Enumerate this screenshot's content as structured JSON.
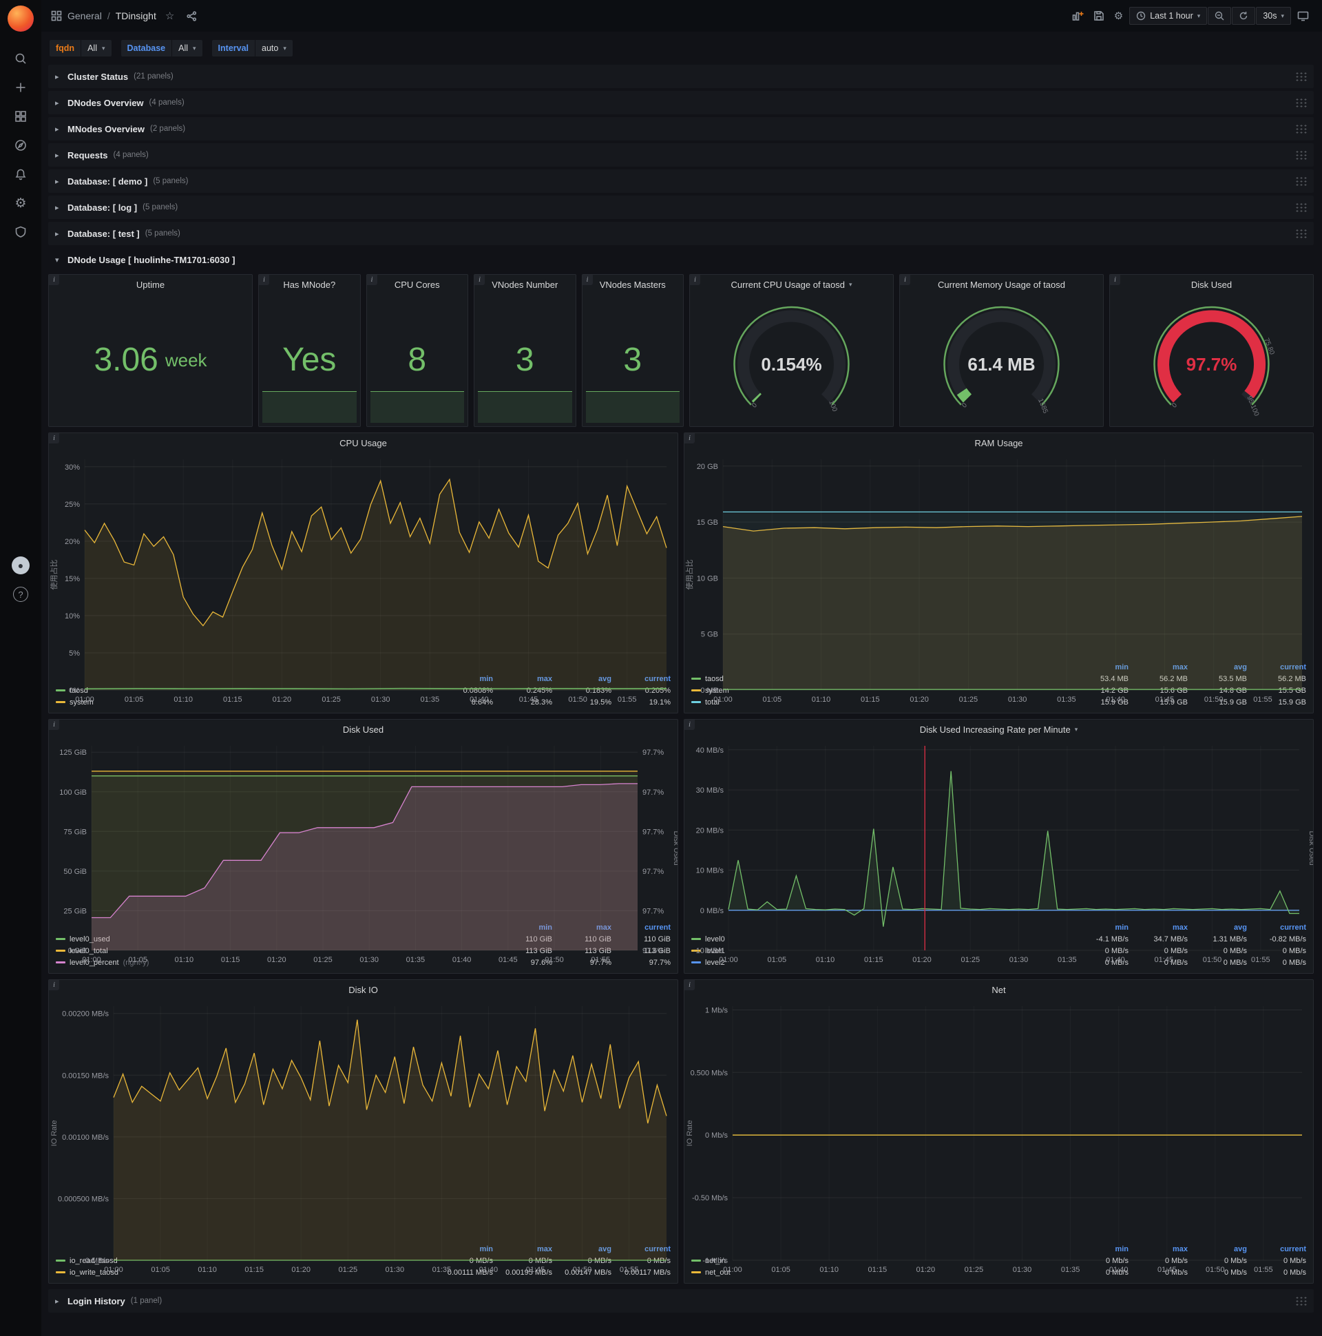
{
  "topnav": {
    "folder": "General",
    "separator": "/",
    "title": "TDinsight",
    "time_range": "Last 1 hour",
    "refresh": "30s"
  },
  "variables": [
    {
      "label": "fqdn",
      "value": "All",
      "color": "#eb7b18"
    },
    {
      "label": "Database",
      "value": "All",
      "color": "#5794f2"
    },
    {
      "label": "Interval",
      "value": "auto",
      "color": "#5794f2"
    }
  ],
  "collapsed_rows": [
    {
      "title": "Cluster Status",
      "count": "(21 panels)"
    },
    {
      "title": "DNodes Overview",
      "count": "(4 panels)"
    },
    {
      "title": "MNodes Overview",
      "count": "(2 panels)"
    },
    {
      "title": "Requests",
      "count": "(4 panels)"
    },
    {
      "title": "Database: [ demo ]",
      "count": "(5 panels)"
    },
    {
      "title": "Database: [ log ]",
      "count": "(5 panels)"
    },
    {
      "title": "Database: [ test ]",
      "count": "(5 panels)"
    }
  ],
  "expanded_row": {
    "title": "DNode Usage [ huolinhe-TM1701:6030 ]"
  },
  "bottom_row": {
    "title": "Login History",
    "count": "(1 panel)"
  },
  "stat_panels": [
    {
      "title": "Uptime",
      "value": "3.06",
      "unit": "week"
    },
    {
      "title": "Has MNode?",
      "value": "Yes",
      "unit": ""
    },
    {
      "title": "CPU Cores",
      "value": "8",
      "unit": ""
    },
    {
      "title": "VNodes Number",
      "value": "3",
      "unit": ""
    },
    {
      "title": "VNodes Masters",
      "value": "3",
      "unit": ""
    }
  ],
  "gauge_panels": [
    {
      "title": "Current CPU Usage of taosd",
      "value": "0.154%",
      "percent": 0.154,
      "min": "0",
      "max": "100",
      "color": "#73bf69",
      "value_color": "#d8d9da"
    },
    {
      "title": "Current Memory Usage of taosd",
      "value": "61.4 MB",
      "percent": 3.9,
      "min": "0",
      "max": "1585",
      "color": "#73bf69",
      "value_color": "#d8d9da"
    },
    {
      "title": "Disk Used",
      "value": "97.7%",
      "percent": 97.7,
      "min": "0",
      "max": "95.100",
      "mid": "75.80",
      "color": "#e02f44",
      "value_color": "#e02f44"
    }
  ],
  "chart_data": [
    {
      "id": "cpu_usage",
      "type": "line",
      "title": "CPU Usage",
      "ylabel": "使用占比",
      "ylim": [
        0,
        31
      ],
      "ml": 52,
      "grid": true,
      "legend_position": "bottom",
      "yticks": [
        {
          "v": 0,
          "t": "0%"
        },
        {
          "v": 5,
          "t": "5%"
        },
        {
          "v": 10,
          "t": "10%"
        },
        {
          "v": 15,
          "t": "15%"
        },
        {
          "v": 20,
          "t": "20%"
        },
        {
          "v": 25,
          "t": "25%"
        },
        {
          "v": 30,
          "t": "30%"
        }
      ],
      "xticks": [
        "01:00",
        "01:05",
        "01:10",
        "01:15",
        "01:20",
        "01:25",
        "01:30",
        "01:35",
        "01:40",
        "01:45",
        "01:50",
        "01:55"
      ],
      "series": [
        {
          "name": "system",
          "color": "#eab839",
          "fill": 0.1,
          "values": [
            21.5,
            19.8,
            22.4,
            20.1,
            17.2,
            16.8,
            21.0,
            19.3,
            20.6,
            18.2,
            12.5,
            10.2,
            8.64,
            10.5,
            9.8,
            13.2,
            16.5,
            18.9,
            23.8,
            19.4,
            16.2,
            21.3,
            18.6,
            23.4,
            24.6,
            20.2,
            21.8,
            18.4,
            20.3,
            24.9,
            28.1,
            22.4,
            25.2,
            20.6,
            23.1,
            19.7,
            26.3,
            28.3,
            21.2,
            18.5,
            22.6,
            20.4,
            24.3,
            21.1,
            19.2,
            23.5,
            17.3,
            16.4,
            20.8,
            22.4,
            25.1,
            18.3,
            21.6,
            26.2,
            19.4,
            27.4,
            24.2,
            21.0,
            23.3,
            19.1
          ]
        },
        {
          "name": "taosd",
          "color": "#73bf69",
          "fill": 0.2,
          "values": [
            0.18,
            0.22,
            0.19,
            0.21,
            0.2,
            0.18,
            0.23,
            0.2,
            0.19,
            0.22,
            0.2,
            0.21
          ]
        }
      ],
      "legend": {
        "cols": [
          "min",
          "max",
          "avg",
          "current"
        ],
        "rows": [
          {
            "name": "taosd",
            "color": "#73bf69",
            "values": [
              "0.0808%",
              "0.245%",
              "0.183%",
              "0.205%"
            ]
          },
          {
            "name": "system",
            "color": "#eab839",
            "values": [
              "8.64%",
              "28.3%",
              "19.5%",
              "19.1%"
            ]
          }
        ]
      }
    },
    {
      "id": "ram_usage",
      "type": "line",
      "title": "RAM Usage",
      "ylabel": "使用占比",
      "ylim": [
        0,
        20.6
      ],
      "ml": 56,
      "grid": true,
      "legend_position": "bottom",
      "yticks": [
        {
          "v": 0,
          "t": "0 MB"
        },
        {
          "v": 5,
          "t": "5 GB"
        },
        {
          "v": 10,
          "t": "10 GB"
        },
        {
          "v": 15,
          "t": "15 GB"
        },
        {
          "v": 20,
          "t": "20 GB"
        }
      ],
      "xticks": [
        "01:00",
        "01:05",
        "01:10",
        "01:15",
        "01:20",
        "01:25",
        "01:30",
        "01:35",
        "01:40",
        "01:45",
        "01:50",
        "01:55"
      ],
      "series": [
        {
          "name": "system",
          "color": "#eab839",
          "fill": 0.12,
          "values": [
            14.6,
            14.2,
            14.45,
            14.5,
            14.4,
            14.5,
            14.55,
            14.5,
            14.6,
            14.65,
            14.6,
            14.65,
            14.7,
            14.75,
            14.8,
            14.9,
            15.0,
            15.1,
            15.3,
            15.5
          ]
        },
        {
          "name": "total",
          "color": "#6ed0e0",
          "fill": 0.05,
          "values": [
            15.9,
            15.9
          ]
        },
        {
          "name": "taosd",
          "color": "#73bf69",
          "fill": 0,
          "values": [
            0.055,
            0.055
          ]
        }
      ],
      "legend": {
        "cols": [
          "min",
          "max",
          "avg",
          "current"
        ],
        "rows": [
          {
            "name": "taosd",
            "color": "#73bf69",
            "values": [
              "53.4 MB",
              "56.2 MB",
              "53.5 MB",
              "56.2 MB"
            ]
          },
          {
            "name": "system",
            "color": "#eab839",
            "values": [
              "14.2 GB",
              "15.6 GB",
              "14.8 GB",
              "15.5 GB"
            ]
          },
          {
            "name": "total",
            "color": "#6ed0e0",
            "values": [
              "15.9 GB",
              "15.9 GB",
              "15.9 GB",
              "15.9 GB"
            ]
          }
        ]
      }
    },
    {
      "id": "disk_used",
      "type": "line",
      "title": "Disk Used",
      "ylabel_right": "Disk Used",
      "ylim": [
        0,
        129
      ],
      "y2lim": [
        97.55,
        97.75
      ],
      "ml": 62,
      "mr": 58,
      "grid": true,
      "yticks": [
        {
          "v": 0,
          "t": "0 GiB",
          "t2": "97.6%"
        },
        {
          "v": 25,
          "t": "25 GiB",
          "t2": "97.7%"
        },
        {
          "v": 50,
          "t": "50 GiB",
          "t2": "97.7%"
        },
        {
          "v": 75,
          "t": "75 GiB",
          "t2": "97.7%"
        },
        {
          "v": 100,
          "t": "100 GiB",
          "t2": "97.7%"
        },
        {
          "v": 125,
          "t": "125 GiB",
          "t2": "97.7%"
        }
      ],
      "xticks": [
        "01:00",
        "01:05",
        "01:10",
        "01:15",
        "01:20",
        "01:25",
        "01:30",
        "01:35",
        "01:40",
        "01:45",
        "01:50",
        "01:55"
      ],
      "series": [
        {
          "name": "level0_used",
          "color": "#73bf69",
          "fill": 0.08,
          "values": [
            110,
            110
          ]
        },
        {
          "name": "level0_total",
          "color": "#eab839",
          "fill": 0.08,
          "values": [
            113,
            113
          ]
        },
        {
          "name": "level0_percent",
          "color": "#d683ce",
          "fill": 0.18,
          "axis": "right",
          "values": [
            97.582,
            97.582,
            97.603,
            97.603,
            97.603,
            97.603,
            97.611,
            97.638,
            97.638,
            97.638,
            97.665,
            97.665,
            97.67,
            97.67,
            97.67,
            97.67,
            97.675,
            97.71,
            97.71,
            97.71,
            97.71,
            97.71,
            97.71,
            97.71,
            97.71,
            97.71,
            97.712,
            97.712,
            97.713,
            97.713
          ]
        }
      ],
      "legend": {
        "cols": [
          "min",
          "max",
          "current"
        ],
        "rows": [
          {
            "name": "level0_used",
            "color": "#73bf69",
            "values": [
              "110 GiB",
              "110 GiB",
              "110 GiB"
            ]
          },
          {
            "name": "level0_total",
            "color": "#eab839",
            "values": [
              "113 GiB",
              "113 GiB",
              "113 GiB"
            ]
          },
          {
            "name": "level0_percent",
            "suffix": "(right-y)",
            "color": "#d683ce",
            "values": [
              "97.6%",
              "97.7%",
              "97.7%"
            ]
          }
        ]
      }
    },
    {
      "id": "disk_rate",
      "type": "line",
      "title": "Disk Used Increasing Rate per Minute",
      "title_dropdown": true,
      "ylabel_right": "Disk Used",
      "ylim": [
        -10,
        41
      ],
      "ml": 64,
      "mr": 20,
      "grid": true,
      "annotations": [
        {
          "x": 20.3,
          "color": "#e02f44"
        }
      ],
      "yticks": [
        {
          "v": -10,
          "t": "-10 MB/s"
        },
        {
          "v": 0,
          "t": "0 MB/s"
        },
        {
          "v": 10,
          "t": "10 MB/s"
        },
        {
          "v": 20,
          "t": "20 MB/s"
        },
        {
          "v": 30,
          "t": "30 MB/s"
        },
        {
          "v": 40,
          "t": "40 MB/s"
        }
      ],
      "xticks": [
        "01:00",
        "01:05",
        "01:10",
        "01:15",
        "01:20",
        "01:25",
        "01:30",
        "01:35",
        "01:40",
        "01:45",
        "01:50",
        "01:55"
      ],
      "series": [
        {
          "name": "level1",
          "color": "#eab839",
          "fill": 0,
          "values": [
            0,
            0
          ]
        },
        {
          "name": "level2",
          "color": "#5794f2",
          "fill": 0,
          "values": [
            0,
            0
          ]
        },
        {
          "name": "level0",
          "color": "#73bf69",
          "fill": 0.1,
          "values": [
            0.2,
            12.5,
            0.3,
            0.1,
            2.1,
            0.2,
            0.3,
            8.6,
            0.4,
            0.2,
            0.1,
            0.3,
            0.2,
            -1.2,
            0.4,
            20.3,
            -4.1,
            10.8,
            0.3,
            0.2,
            0.4,
            0.3,
            0.2,
            34.7,
            0.5,
            0.3,
            0.2,
            0.4,
            0.3,
            0.2,
            0.3,
            0.2,
            0.4,
            19.8,
            0.3,
            0.2,
            0.3,
            0.4,
            0.2,
            0.3,
            0.2,
            0.3,
            0.4,
            0.2,
            0.3,
            0.2,
            0.4,
            0.3,
            0.2,
            0.3,
            0.4,
            0.2,
            0.3,
            0.2,
            0.3,
            0.4,
            0.2,
            4.8,
            -0.82,
            -0.82
          ]
        }
      ],
      "legend": {
        "cols": [
          "min",
          "max",
          "avg",
          "current"
        ],
        "rows": [
          {
            "name": "level0",
            "color": "#73bf69",
            "values": [
              "-4.1 MB/s",
              "34.7 MB/s",
              "1.31 MB/s",
              "-0.82 MB/s"
            ]
          },
          {
            "name": "level1",
            "color": "#eab839",
            "values": [
              "0 MB/s",
              "0 MB/s",
              "0 MB/s",
              "0 MB/s"
            ]
          },
          {
            "name": "level2",
            "color": "#5794f2",
            "values": [
              "0 MB/s",
              "0 MB/s",
              "0 MB/s",
              "0 MB/s"
            ]
          }
        ]
      }
    },
    {
      "id": "disk_io",
      "type": "line",
      "title": "Disk IO",
      "ylabel": "IO Rate",
      "ylim": [
        0,
        0.00206
      ],
      "ml": 94,
      "grid": true,
      "yticks": [
        {
          "v": 0,
          "t": "0 MB/s"
        },
        {
          "v": 0.0005,
          "t": "0.000500 MB/s"
        },
        {
          "v": 0.001,
          "t": "0.00100 MB/s"
        },
        {
          "v": 0.0015,
          "t": "0.00150 MB/s"
        },
        {
          "v": 0.002,
          "t": "0.00200 MB/s"
        }
      ],
      "xticks": [
        "01:00",
        "01:05",
        "01:10",
        "01:15",
        "01:20",
        "01:25",
        "01:30",
        "01:35",
        "01:40",
        "01:45",
        "01:50",
        "01:55"
      ],
      "series": [
        {
          "name": "io_read_taosd",
          "color": "#73bf69",
          "fill": 0,
          "values": [
            0,
            0
          ]
        },
        {
          "name": "io_write_taosd",
          "color": "#eab839",
          "fill": 0.12,
          "values": [
            0.00132,
            0.00151,
            0.00128,
            0.00141,
            0.00135,
            0.00129,
            0.00152,
            0.00138,
            0.00147,
            0.00156,
            0.00131,
            0.00149,
            0.00172,
            0.00128,
            0.00143,
            0.00168,
            0.00126,
            0.00155,
            0.00139,
            0.00162,
            0.00148,
            0.0013,
            0.00178,
            0.00125,
            0.00158,
            0.00144,
            0.00195,
            0.00122,
            0.0015,
            0.00136,
            0.00165,
            0.00127,
            0.00173,
            0.00142,
            0.00129,
            0.0016,
            0.00133,
            0.00182,
            0.00124,
            0.00151,
            0.00139,
            0.0017,
            0.00126,
            0.00157,
            0.00145,
            0.00188,
            0.00121,
            0.00154,
            0.00137,
            0.00166,
            0.00128,
            0.00159,
            0.00131,
            0.00175,
            0.00123,
            0.00148,
            0.00161,
            0.00111,
            0.00142,
            0.00117
          ]
        }
      ],
      "legend": {
        "cols": [
          "min",
          "max",
          "avg",
          "current"
        ],
        "rows": [
          {
            "name": "io_read_taosd",
            "color": "#73bf69",
            "values": [
              "0 MB/s",
              "0 MB/s",
              "0 MB/s",
              "0 MB/s"
            ]
          },
          {
            "name": "io_write_taosd",
            "color": "#eab839",
            "values": [
              "0.00111 MB/s",
              "0.00195 MB/s",
              "0.00147 MB/s",
              "0.00117 MB/s"
            ]
          }
        ]
      }
    },
    {
      "id": "net",
      "type": "line",
      "title": "Net",
      "ylabel": "IO Rate",
      "ylim": [
        -1,
        1.03
      ],
      "ml": 70,
      "grid": true,
      "yticks": [
        {
          "v": -1,
          "t": "-1 Mb/s"
        },
        {
          "v": -0.5,
          "t": "-0.50 Mb/s"
        },
        {
          "v": 0,
          "t": "0 Mb/s"
        },
        {
          "v": 0.5,
          "t": "0.500 Mb/s"
        },
        {
          "v": 1,
          "t": "1 Mb/s"
        }
      ],
      "xticks": [
        "01:00",
        "01:05",
        "01:10",
        "01:15",
        "01:20",
        "01:25",
        "01:30",
        "01:35",
        "01:40",
        "01:45",
        "01:50",
        "01:55"
      ],
      "series": [
        {
          "name": "net_in",
          "color": "#73bf69",
          "fill": 0,
          "values": [
            0,
            0
          ]
        },
        {
          "name": "net_out",
          "color": "#eab839",
          "fill": 0,
          "values": [
            0,
            0
          ]
        }
      ],
      "legend": {
        "cols": [
          "min",
          "max",
          "avg",
          "current"
        ],
        "rows": [
          {
            "name": "net_in",
            "color": "#73bf69",
            "values": [
              "0 Mb/s",
              "0 Mb/s",
              "0 Mb/s",
              "0 Mb/s"
            ]
          },
          {
            "name": "net_out",
            "color": "#eab839",
            "values": [
              "0 Mb/s",
              "0 Mb/s",
              "0 Mb/s",
              "0 Mb/s"
            ]
          }
        ]
      }
    }
  ]
}
